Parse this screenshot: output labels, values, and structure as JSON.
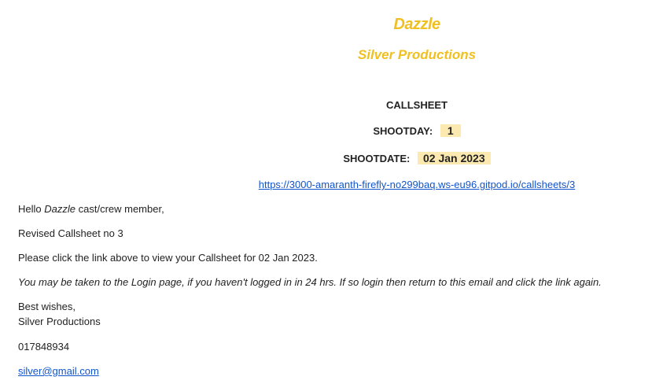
{
  "header": {
    "title": "Dazzle",
    "subtitle": "Silver Productions"
  },
  "callsheet": {
    "heading": "CALLSHEET",
    "shootday_label": "SHOOTDAY:",
    "shootday_value": "1",
    "shootdate_label": "SHOOTDATE:",
    "shootdate_value": "02 Jan 2023",
    "url": "https://3000-amaranth-firefly-no299baq.ws-eu96.gitpod.io/callsheets/3"
  },
  "body": {
    "greeting_prefix": "Hello ",
    "greeting_production": "Dazzle",
    "greeting_suffix": " cast/crew member,",
    "revision_line": "Revised Callsheet no 3",
    "instruction_line": "Please click the link above to view your Callsheet for 02 Jan 2023.",
    "login_note": "You may be taken to the Login page, if you haven't logged in in 24 hrs. If so login then return to this email and click the link again.",
    "signoff": "Best wishes,",
    "signature": "Silver Productions",
    "phone": "017848934",
    "email": "silver@gmail.com"
  },
  "colors": {
    "brand_gold": "#f0c020",
    "highlight": "#fbe9b0",
    "link": "#1155cc"
  }
}
